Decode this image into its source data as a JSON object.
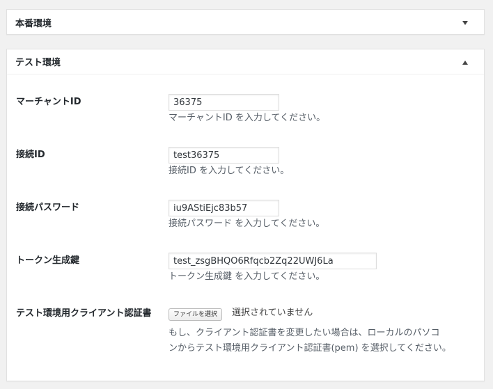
{
  "panels": {
    "production": {
      "title": "本番環境",
      "toggle_icon": "triangle-down-icon",
      "collapsed": true
    },
    "test": {
      "title": "テスト環境",
      "toggle_icon": "triangle-up-icon",
      "collapsed": false
    }
  },
  "fields": {
    "merchant_id": {
      "label": "マーチャントID",
      "value": "36375",
      "description": "マーチャントID を入力してください。"
    },
    "connection_id": {
      "label": "接続ID",
      "value": "test36375",
      "description": "接続ID を入力してください。"
    },
    "connection_password": {
      "label": "接続パスワード",
      "value": "iu9AStiEjc83b57",
      "description": "接続パスワード を入力してください。"
    },
    "token_key": {
      "label": "トークン生成鍵",
      "value": "test_zsgBHQO6Rfqcb2Zq22UWJ6La",
      "description": "トークン生成鍵 を入力してください。"
    },
    "client_cert": {
      "label": "テスト環境用クライアント認証書",
      "button_label": "ファイルを選択",
      "status": "選択されていません",
      "description_line1": "もし、クライアント認証書を変更したい場合は、ローカルのパソコ",
      "description_line2": "ンからテスト環境用クライアント認証書(pem) を選択してください。"
    }
  },
  "colors": {
    "background": "#f1f1f1",
    "panel": "#ffffff",
    "border": "#e1e1e1",
    "text": "#23282d",
    "description": "#555d66"
  }
}
